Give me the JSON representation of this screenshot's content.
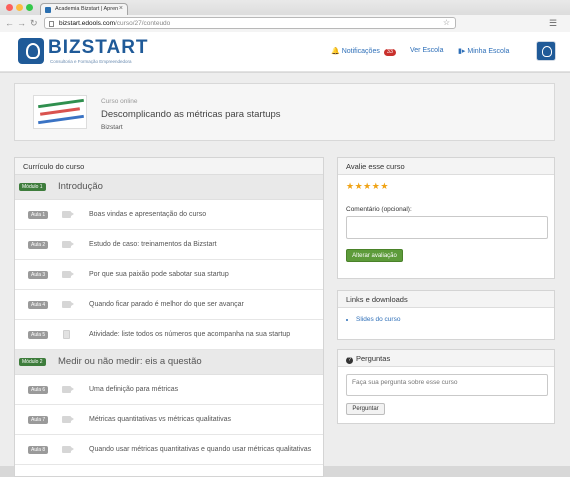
{
  "browser": {
    "tab_title": "Academia Bizstart | Apren",
    "tab_close": "×",
    "url_host": "bizstart.edools.com",
    "url_path": "/curso/27/conteudo",
    "colors": {
      "close": "#fc605b",
      "min": "#fdbc40",
      "max": "#34c84a"
    }
  },
  "header": {
    "logo_text": "BIZSTART",
    "logo_tagline": "Consultoria e Formação Empreendedora",
    "notifications_label": "Notificações",
    "notifications_count": "33",
    "view_school_label": "Ver Escola",
    "my_school_label": "Minha Escola"
  },
  "course": {
    "label": "Curso online",
    "title": "Descomplicando as métricas para startups",
    "owner": "Bizstart"
  },
  "curriculum": {
    "title": "Currículo do curso",
    "modules": [
      {
        "badge": "Módulo 1",
        "title": "Introdução",
        "lessons": [
          {
            "badge": "Aula 1",
            "title": "Boas vindas e apresentação do curso",
            "type": "video"
          },
          {
            "badge": "Aula 2",
            "title": "Estudo de caso: treinamentos da Bizstart",
            "type": "video"
          },
          {
            "badge": "Aula 3",
            "title": "Por que sua paixão pode sabotar sua startup",
            "type": "video"
          },
          {
            "badge": "Aula 4",
            "title": "Quando ficar parado é melhor do que ser avançar",
            "type": "video"
          },
          {
            "badge": "Aula 5",
            "title": "Atividade: liste todos os números que acompanha na sua startup",
            "type": "doc"
          }
        ]
      },
      {
        "badge": "Módulo 2",
        "title": "Medir ou não medir: eis a questão",
        "lessons": [
          {
            "badge": "Aula 6",
            "title": "Uma definição para métricas",
            "type": "video"
          },
          {
            "badge": "Aula 7",
            "title": "Métricas quantitativas vs métricas qualitativas",
            "type": "video"
          },
          {
            "badge": "Aula 8",
            "title": "Quando usar métricas quantitativas e quando usar métricas qualitativas",
            "type": "video"
          }
        ]
      }
    ]
  },
  "rating": {
    "title": "Avalie esse curso",
    "stars": 5,
    "comment_label": "Comentário (opcional):",
    "comment_value": "",
    "submit_label": "Alterar avaliação"
  },
  "links": {
    "title": "Links e downloads",
    "items": [
      "Slides do curso"
    ]
  },
  "questions": {
    "title": "Perguntas",
    "placeholder": "Faça sua pergunta sobre esse curso",
    "submit_label": "Perguntar"
  }
}
